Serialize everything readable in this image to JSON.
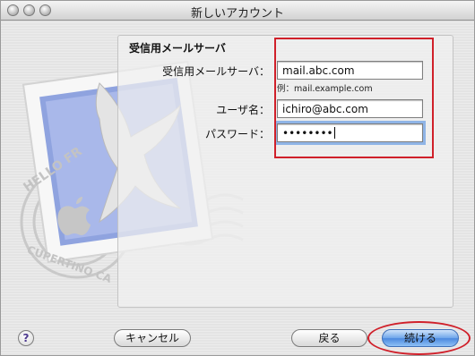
{
  "window": {
    "title": "新しいアカウント"
  },
  "section": {
    "title": "受信用メールサーバ"
  },
  "form": {
    "server_label": "受信用メールサーバ：",
    "server_value": "mail.abc.com",
    "server_hint": "例：mail.example.com",
    "username_label": "ユーザ名：",
    "username_value": "ichiro@abc.com",
    "password_label": "パスワード：",
    "password_value": "••••••••"
  },
  "buttons": {
    "help": "?",
    "cancel": "キャンセル",
    "back": "戻る",
    "continue": "続ける"
  },
  "stamp": {
    "text_top": "HELLO FR",
    "text_bottom": "CUPERTINO CA"
  },
  "colors": {
    "highlight": "#d0202a",
    "accent": "#4b89df"
  }
}
